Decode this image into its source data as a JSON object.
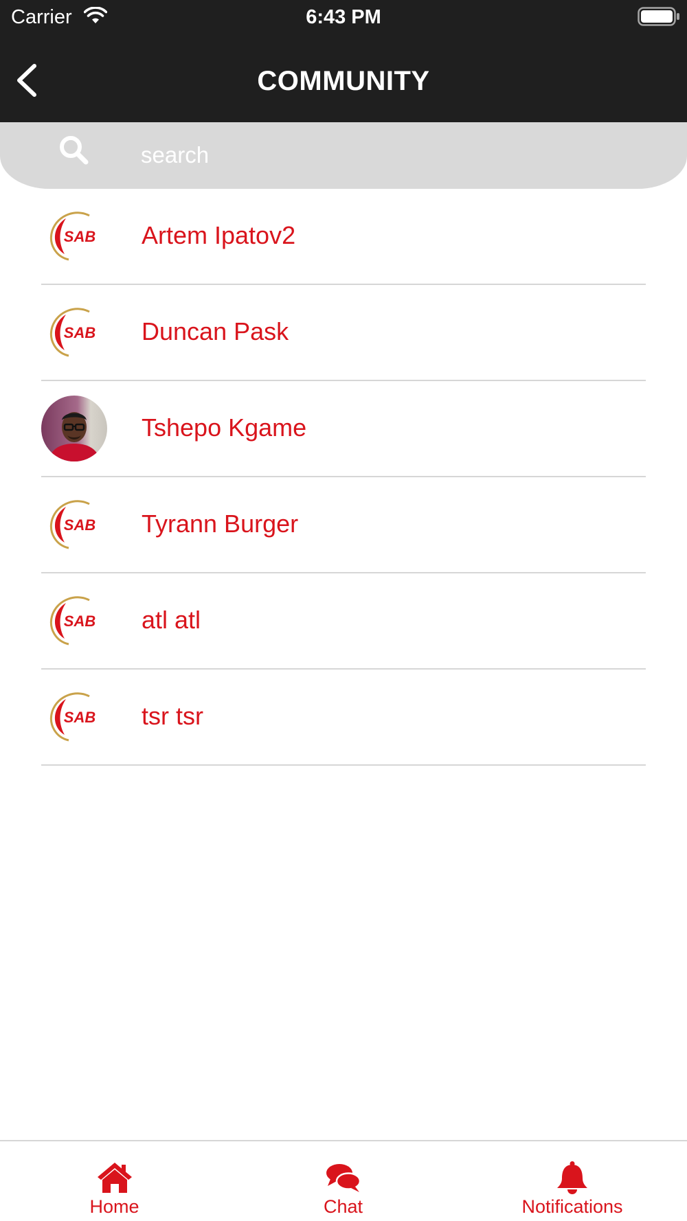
{
  "status_bar": {
    "carrier": "Carrier",
    "time": "6:43 PM"
  },
  "header": {
    "title": "COMMUNITY",
    "back_icon": "chevron-left-icon"
  },
  "search": {
    "placeholder": "search",
    "value": "",
    "icon": "search-icon"
  },
  "members": [
    {
      "name": "Artem Ipatov2",
      "avatar": "sab-logo"
    },
    {
      "name": "Duncan Pask",
      "avatar": "sab-logo"
    },
    {
      "name": "Tshepo Kgame",
      "avatar": "user-photo"
    },
    {
      "name": "Tyrann Burger",
      "avatar": "sab-logo"
    },
    {
      "name": "atl atl",
      "avatar": "sab-logo"
    },
    {
      "name": "tsr tsr",
      "avatar": "sab-logo"
    }
  ],
  "sab_logo_text": "SAB",
  "tabs": [
    {
      "label": "Home",
      "icon": "home-icon"
    },
    {
      "label": "Chat",
      "icon": "chat-bubbles-icon"
    },
    {
      "label": "Notifications",
      "icon": "bell-icon"
    }
  ],
  "colors": {
    "accent": "#d9141c",
    "header_bg": "#1f1f1f",
    "search_bg": "#d9d9d9",
    "logo_gold": "#c9a24a"
  }
}
